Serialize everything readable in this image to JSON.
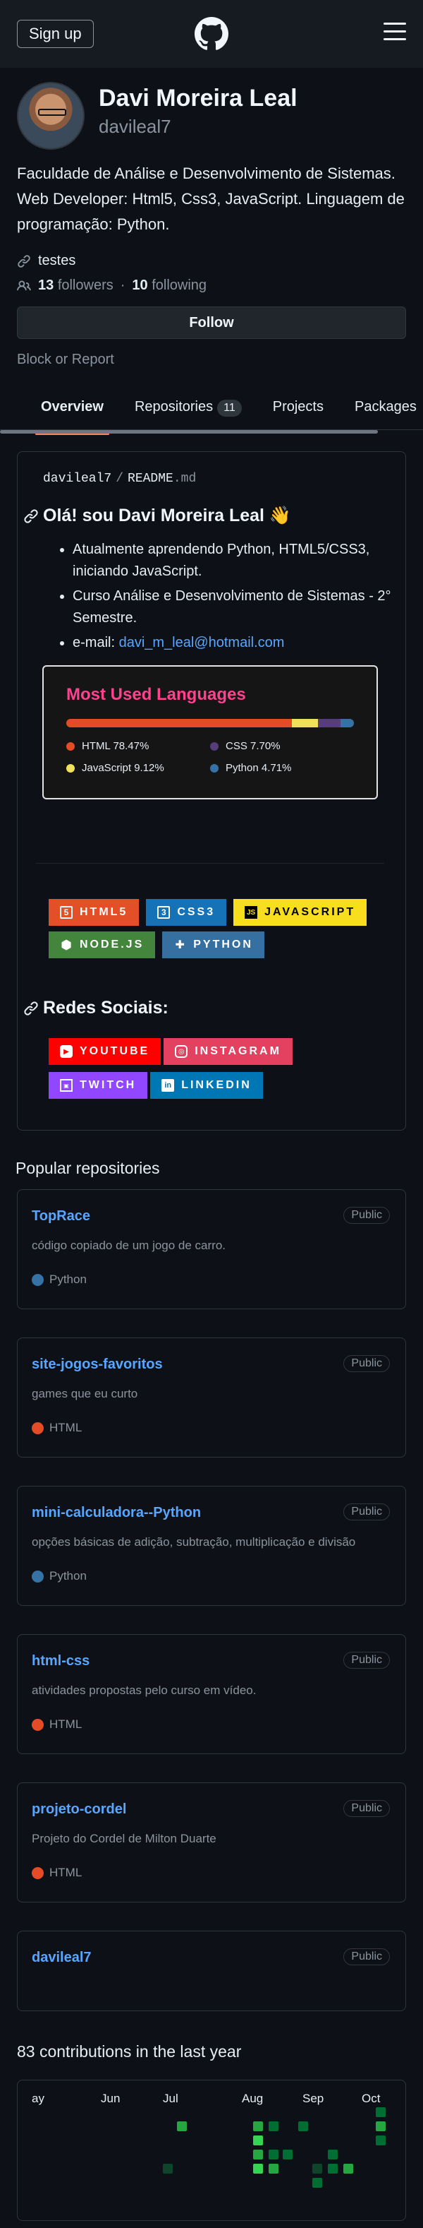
{
  "header": {
    "signup_label": "Sign up"
  },
  "profile": {
    "name": "Davi Moreira Leal",
    "login": "davileal7",
    "bio": "Faculdade de Análise e Desenvolvimento de Sistemas. Web Developer: Html5, Css3, JavaScript. Linguagem de programação: Python.",
    "link": "testes",
    "followers_count": "13",
    "followers_label": "followers",
    "following_count": "10",
    "following_label": "following",
    "dot_separator": "·",
    "follow_label": "Follow",
    "block_label": "Block or Report"
  },
  "tabs": [
    {
      "label": "Overview"
    },
    {
      "label": "Repositories",
      "count": "11"
    },
    {
      "label": "Projects"
    },
    {
      "label": "Packages"
    }
  ],
  "readme": {
    "owner": "davileal7",
    "separator": "/",
    "file": "README",
    "ext": ".md",
    "heading": "Olá! sou Davi Moreira Leal 👋",
    "bullets": [
      "Atualmente aprendendo Python, HTML5/CSS3, iniciando JavaScript.",
      "Curso Análise e Desenvolvimento de Sistemas - 2° Semestre."
    ],
    "email_prefix": "e-mail: ",
    "email": "davi_m_leal@hotmail.com",
    "social_heading": "Redes Sociais:"
  },
  "languages": {
    "title": "Most Used Languages",
    "items": [
      {
        "name": "HTML 78.47%",
        "color": "#e34c26",
        "percent": 78.47
      },
      {
        "name": "CSS 7.70%",
        "color": "#563d7c",
        "percent": 7.7
      },
      {
        "name": "JavaScript 9.12%",
        "color": "#f1e05a",
        "percent": 9.12
      },
      {
        "name": "Python 4.71%",
        "color": "#3572a5",
        "percent": 4.71
      }
    ],
    "bar_order": [
      0,
      2,
      1,
      3
    ]
  },
  "tech_badges": [
    {
      "label": "HTML5",
      "bg": "#e34f26",
      "icon": "html5-icon",
      "glyph": "5"
    },
    {
      "label": "CSS3",
      "bg": "#1572b6",
      "icon": "css3-icon",
      "glyph": "3"
    },
    {
      "label": "JAVASCRIPT",
      "bg": "#f7df1e",
      "fg": "#000000",
      "icon": "javascript-icon",
      "glyph": "JS"
    },
    {
      "label": "NODE.JS",
      "bg": "#43853d",
      "icon": "nodejs-icon",
      "glyph": "⬢"
    },
    {
      "label": "PYTHON",
      "bg": "#3670a0",
      "icon": "python-icon",
      "glyph": "✚"
    }
  ],
  "social_badges": [
    {
      "label": "YOUTUBE",
      "bg": "#ff0000",
      "icon": "youtube-icon",
      "glyph": "▶"
    },
    {
      "label": "INSTAGRAM",
      "bg": "#e4405f",
      "icon": "instagram-icon",
      "glyph": "◎"
    },
    {
      "label": "TWITCH",
      "bg": "#9146ff",
      "icon": "twitch-icon",
      "glyph": "▣"
    },
    {
      "label": "LINKEDIN",
      "bg": "#0077b5",
      "icon": "linkedin-icon",
      "glyph": "in"
    }
  ],
  "popular": {
    "title": "Popular repositories",
    "public_label": "Public",
    "repos": [
      {
        "name": "TopRace",
        "desc": "código copiado de um jogo de carro.",
        "lang": "Python",
        "color": "#3572a5"
      },
      {
        "name": "site-jogos-favoritos",
        "desc": "games que eu curto",
        "lang": "HTML",
        "color": "#e34c26"
      },
      {
        "name": "mini-calculadora--Python",
        "desc": "opções básicas de adição, subtração, multiplicação e divisão",
        "lang": "Python",
        "color": "#3572a5"
      },
      {
        "name": "html-css",
        "desc": "atividades propostas pelo curso em vídeo.",
        "lang": "HTML",
        "color": "#e34c26"
      },
      {
        "name": "projeto-cordel",
        "desc": "Projeto do Cordel de Milton Duarte",
        "lang": "HTML",
        "color": "#e34c26"
      },
      {
        "name": "davileal7",
        "desc": "",
        "lang": "",
        "color": ""
      }
    ]
  },
  "contributions": {
    "title": "83 contributions in the last year",
    "months": [
      "ay",
      "Jun",
      "Jul",
      "Aug",
      "Sep",
      "Oct"
    ]
  }
}
